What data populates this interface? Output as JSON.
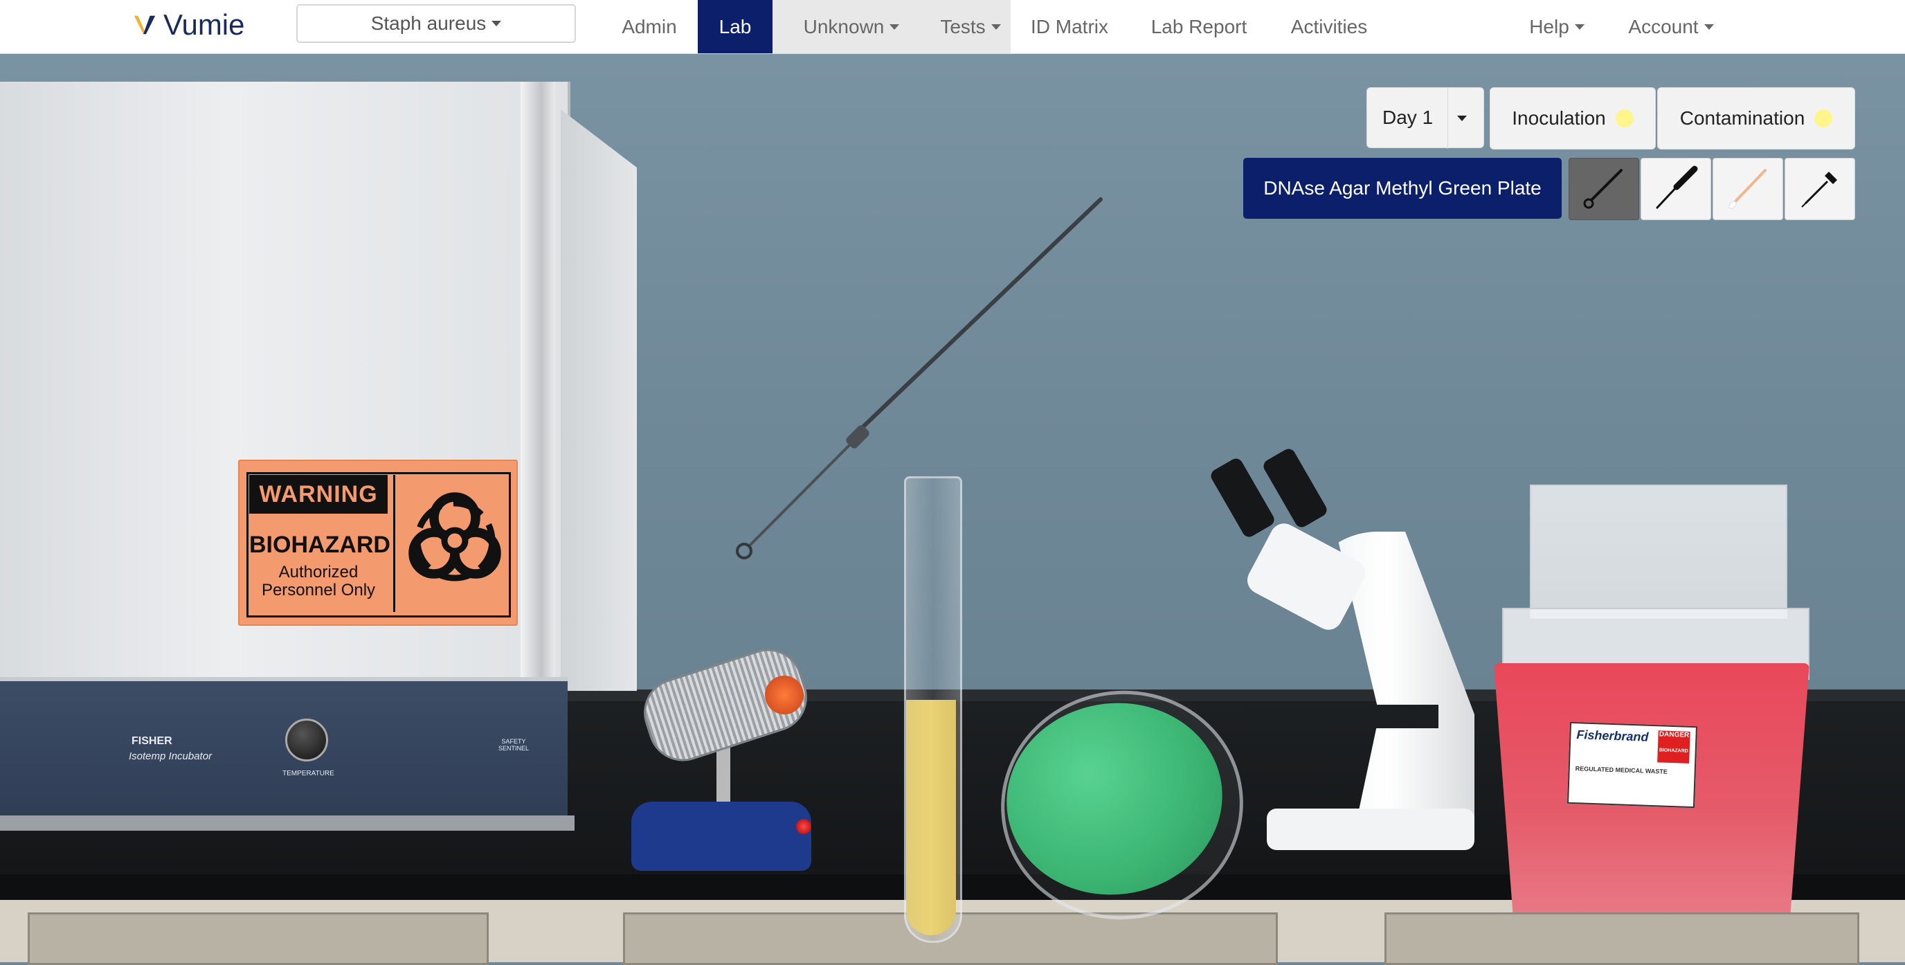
{
  "navbar": {
    "brand": "Vumie",
    "organism_select": "Staph aureus",
    "items": [
      {
        "label": "Admin"
      },
      {
        "label": "Lab"
      },
      {
        "label": "Unknown"
      },
      {
        "label": "Tests"
      },
      {
        "label": "ID Matrix"
      },
      {
        "label": "Lab Report"
      },
      {
        "label": "Activities"
      },
      {
        "label": "Help"
      },
      {
        "label": "Account"
      }
    ],
    "active": "Lab"
  },
  "controls": {
    "day_select": "Day 1",
    "inoculation_label": "Inoculation",
    "contamination_label": "Contamination",
    "plate_label": "DNAse Agar Methyl Green Plate",
    "tools": [
      {
        "icon": "inoculating-loop-icon",
        "selected": true
      },
      {
        "icon": "inoculating-needle-icon",
        "selected": false
      },
      {
        "icon": "swab-icon",
        "selected": false
      },
      {
        "icon": "dropper-icon",
        "selected": false
      }
    ]
  },
  "scene": {
    "warning_label": {
      "title": "WARNING",
      "hazard": "BIOHAZARD",
      "line1": "Authorized",
      "line2": "Personnel Only"
    },
    "incubator": {
      "brand": "FISHER",
      "model": "Isotemp Incubator",
      "knob_label": "TEMPERATURE",
      "sentinel": "SAFETY SENTINEL"
    },
    "sharps_label": {
      "brand": "Fisherbrand",
      "danger": "DANGER",
      "hazard": "BIOHAZARD",
      "waste": "REGULATED MEDICAL WASTE"
    }
  },
  "colors": {
    "brand_navy": "#0b1f6b",
    "status_dot": "#fff58a",
    "agar_green": "#2fb06a",
    "broth_yellow": "#e0c455",
    "sharps_red": "#e9485a"
  }
}
